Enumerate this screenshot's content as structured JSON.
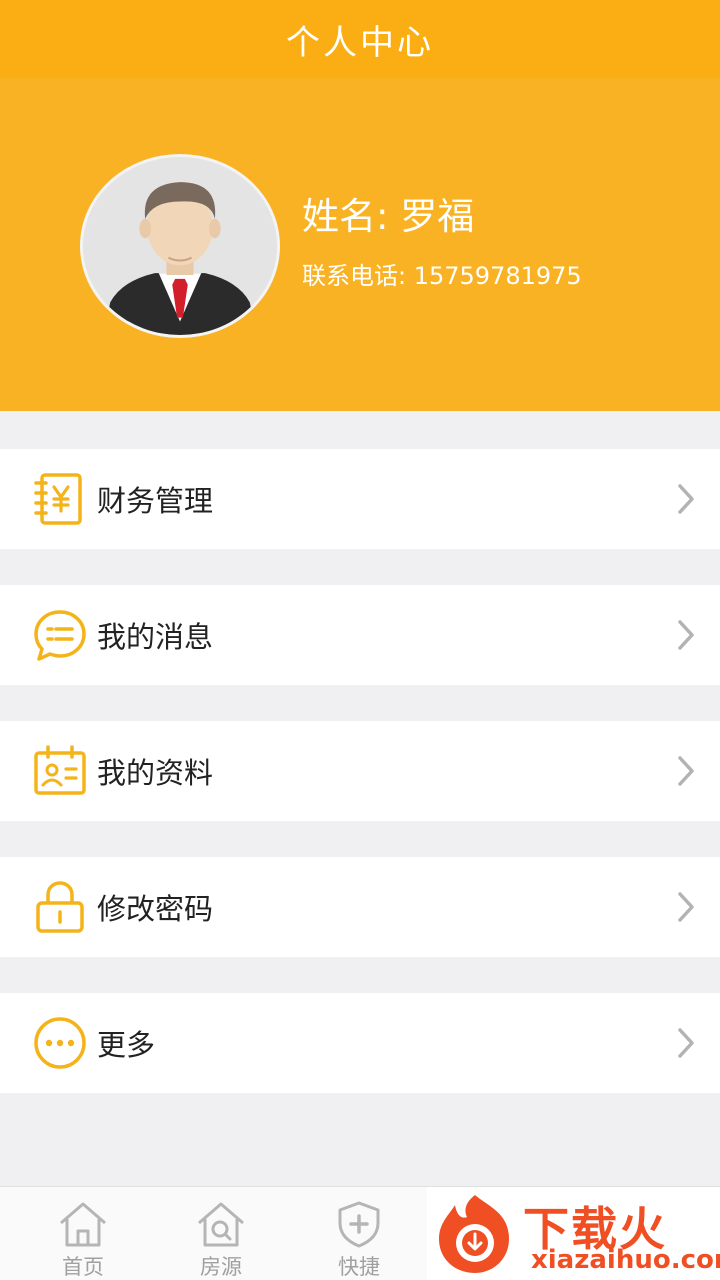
{
  "header": {
    "title": "个人中心"
  },
  "profile": {
    "name": "姓名: 罗福",
    "phone": "联系电话: 15759781975"
  },
  "menu": [
    {
      "label": "财务管理",
      "icon": "finance-icon"
    },
    {
      "label": "我的消息",
      "icon": "message-icon"
    },
    {
      "label": "我的资料",
      "icon": "profile-card-icon"
    },
    {
      "label": "修改密码",
      "icon": "lock-icon"
    },
    {
      "label": "更多",
      "icon": "more-icon"
    }
  ],
  "tabbar": [
    {
      "label": "首页",
      "icon": "home-icon"
    },
    {
      "label": "房源",
      "icon": "house-search-icon"
    },
    {
      "label": "快捷",
      "icon": "shield-plus-icon"
    }
  ],
  "watermark": {
    "brand": "下载火",
    "url": "xiazaihuo.com"
  },
  "colors": {
    "accent": "#fbae14",
    "profile_bg": "#f9b223",
    "icon": "#f5b31a"
  }
}
